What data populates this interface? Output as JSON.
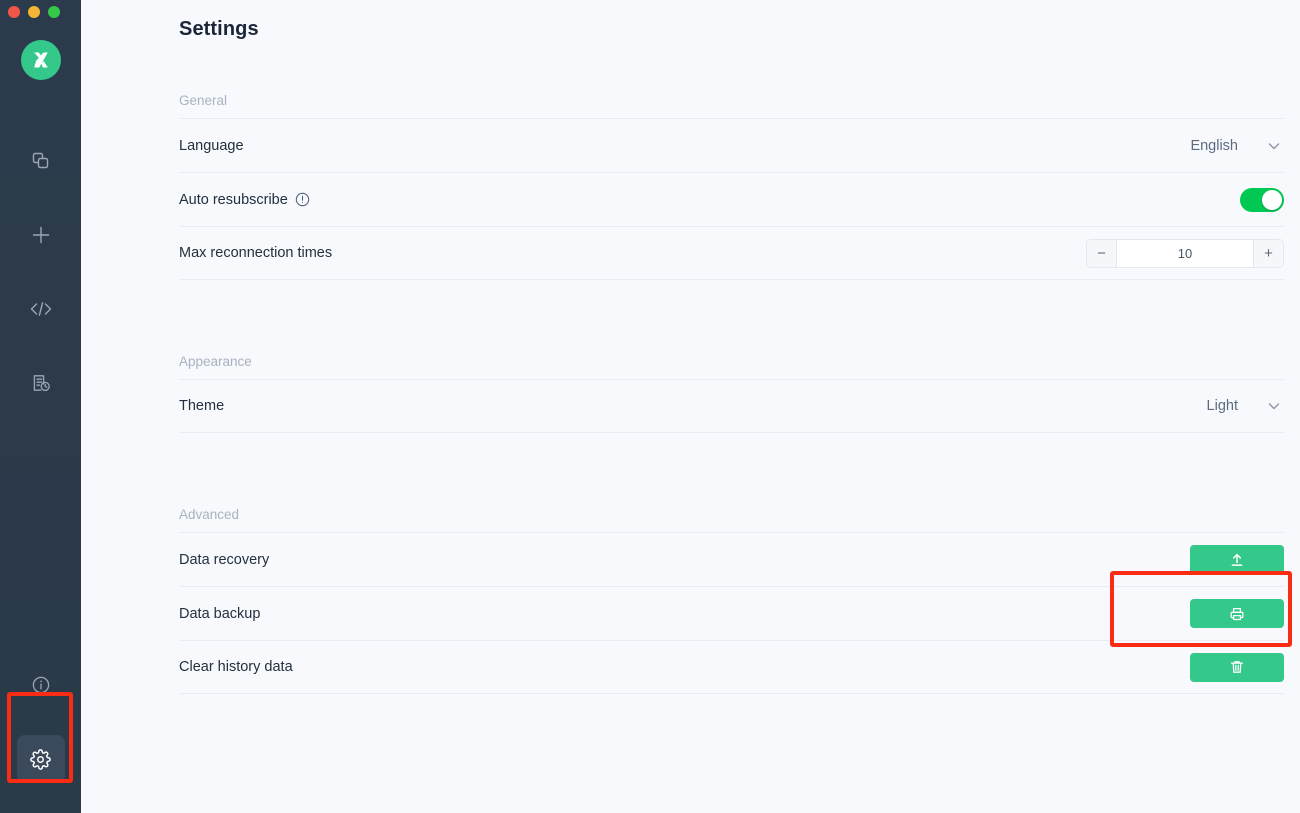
{
  "window": {
    "traffic_lights": [
      "close",
      "minimize",
      "maximize"
    ],
    "colors": {
      "accent_green": "#34c88a",
      "toggle_green": "#00c853",
      "sidebar": "#2b3a4a",
      "annotation": "#fb2c14",
      "background": "#f7f9fc"
    }
  },
  "sidebar": {
    "logo_name": "mqttx-logo",
    "items": [
      {
        "name": "connections",
        "icon": "copy-squares-icon",
        "active": false
      },
      {
        "name": "new-connection",
        "icon": "plus-icon",
        "active": false
      },
      {
        "name": "scripts",
        "icon": "code-brackets-icon",
        "active": false
      },
      {
        "name": "log",
        "icon": "document-clock-icon",
        "active": false
      }
    ],
    "bottom_items": [
      {
        "name": "about",
        "icon": "info-circle-icon",
        "active": false
      },
      {
        "name": "settings",
        "icon": "gear-icon",
        "active": true
      }
    ]
  },
  "header": {
    "title": "Settings"
  },
  "sections": [
    {
      "label": "General",
      "rows": [
        {
          "label": "Language",
          "control": "select",
          "value": "English"
        },
        {
          "label": "Auto resubscribe",
          "control": "toggle",
          "value": "on",
          "has_info_icon": true
        },
        {
          "label": "Max reconnection times",
          "control": "stepper",
          "value": "10",
          "minus": "−",
          "plus": "+"
        }
      ]
    },
    {
      "label": "Appearance",
      "rows": [
        {
          "label": "Theme",
          "control": "select",
          "value": "Light"
        }
      ]
    },
    {
      "label": "Advanced",
      "rows": [
        {
          "label": "Data recovery",
          "control": "button",
          "icon": "upload-icon"
        },
        {
          "label": "Data backup",
          "control": "button",
          "icon": "printer-save-icon"
        },
        {
          "label": "Clear history data",
          "control": "button",
          "icon": "trash-icon"
        }
      ]
    }
  ],
  "annotations": [
    {
      "name": "settings-gear-highlight",
      "target": "sidebar settings gear"
    },
    {
      "name": "data-recovery-highlight",
      "target": "data recovery row button"
    }
  ]
}
